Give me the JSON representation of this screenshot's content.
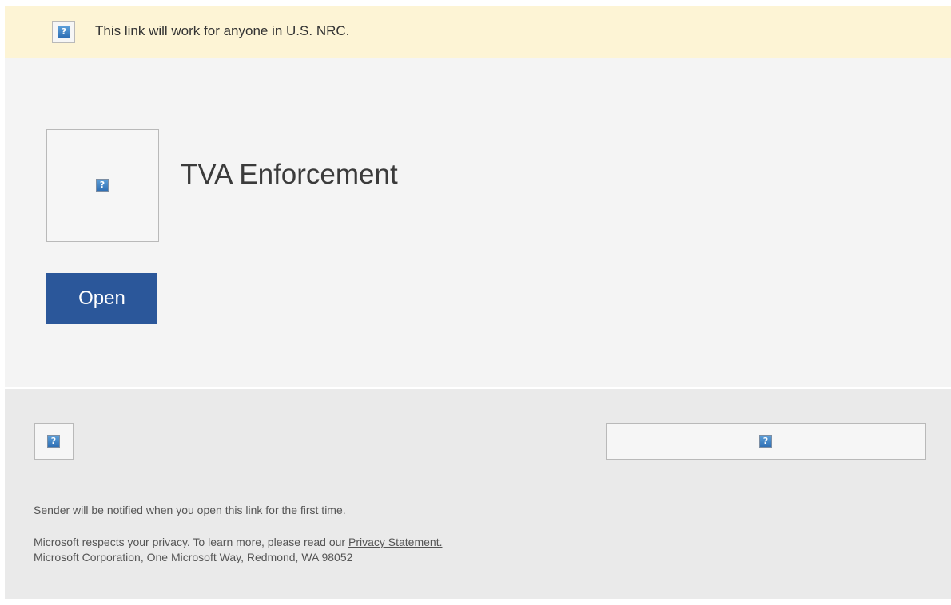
{
  "notice": {
    "icon": "broken-image-icon",
    "text": "This link will work for anyone in U.S. NRC."
  },
  "document": {
    "thumbnail_icon": "broken-image-icon",
    "title": "TVA Enforcement"
  },
  "open_button": {
    "label": "Open",
    "color": "#2b579a"
  },
  "footer": {
    "notification_text": "Sender will be notified when you open this link for the first time.",
    "privacy_text": "Microsoft respects your privacy. To learn more, please read our ",
    "privacy_link": "Privacy Statement.",
    "address": "Microsoft Corporation, One Microsoft Way, Redmond, WA 98052"
  },
  "colors": {
    "notice_bg": "#fdf4d5",
    "card_bg": "#f4f4f4",
    "footer_bg": "#eaeaea"
  }
}
